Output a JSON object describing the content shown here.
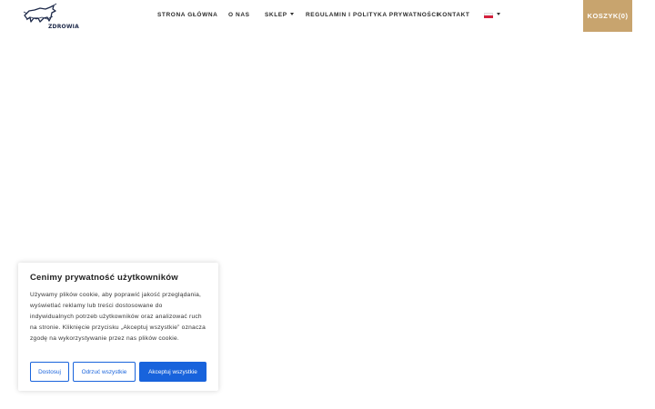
{
  "logo": {
    "text": "ZDROWIA",
    "icon": "bull-logo-icon"
  },
  "nav": {
    "items": [
      {
        "label": "STRONA GŁÓWNA",
        "dropdown": false
      },
      {
        "label": "O NAS",
        "dropdown": false
      },
      {
        "label": "SKLEP",
        "dropdown": true
      },
      {
        "label": "REGULAMIN I POLITYKA PRYWATNOŚCI",
        "dropdown": false
      },
      {
        "label": "KONTAKT",
        "dropdown": false
      }
    ],
    "language_icon": "poland-flag-icon"
  },
  "cart": {
    "label": "KOSZYK(0)",
    "color": "#c8a46e"
  },
  "cookie_banner": {
    "title": "Cenimy prywatność użytkowników",
    "text": "Używamy plików cookie, aby poprawić jakość przeglądania, wyświetlać reklamy lub treści dostosowane do indywidualnych potrzeb użytkowników oraz analizować ruch na stronie. Kliknięcie przycisku „Akceptuj wszystkie” oznacza zgodę na wykorzystywanie przez nas plików cookie.",
    "buttons": {
      "customize": "Dostosuj",
      "reject": "Odrzuć wszystkie",
      "accept": "Akceptuj wszystkie"
    },
    "accent_color": "#1863dc"
  }
}
